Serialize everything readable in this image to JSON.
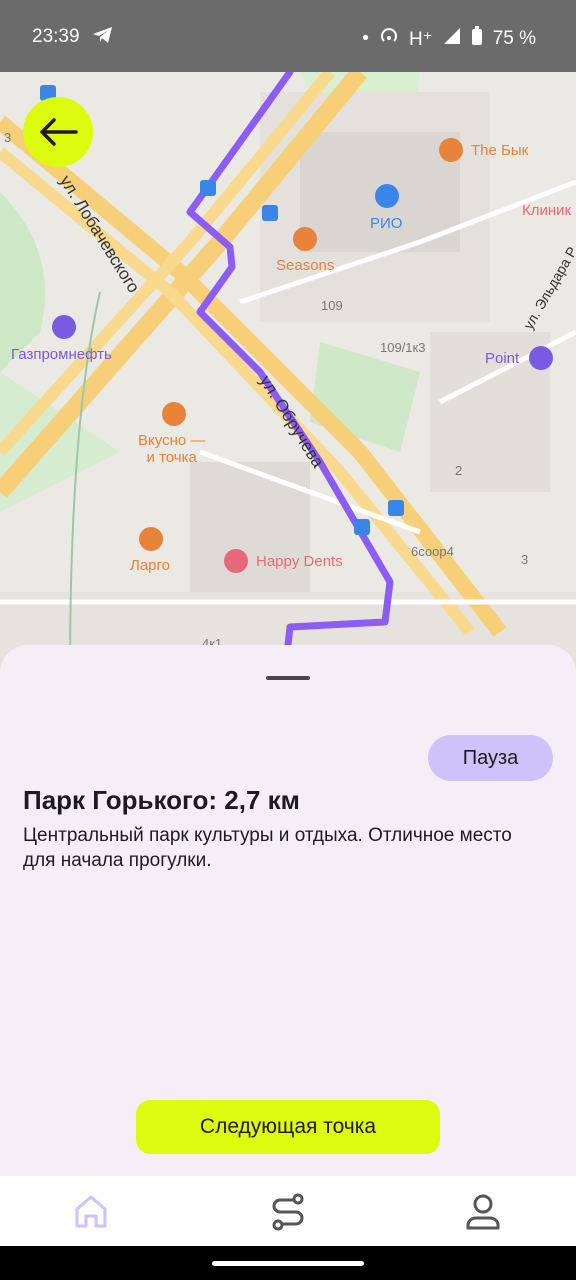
{
  "status_bar": {
    "time": "23:39",
    "network": "H⁺",
    "battery": "75 %"
  },
  "map": {
    "streets": [
      "ул. Лобачевского",
      "ул. Обручева",
      "ул. Эльдара Р"
    ],
    "pois": {
      "the_byk": "The Бык",
      "rio": "РИО",
      "seasons": "Seasons",
      "gazpromneft": "Газпромнефть",
      "vkusno": "Вкусно —\nи точка",
      "largo": "Ларго",
      "happy_dents": "Happy Dents",
      "point": "Point",
      "clinic": "Клиник"
    },
    "house_numbers": [
      "109",
      "109/1к3",
      "2",
      "6соор4",
      "3",
      "3",
      "4к1"
    ],
    "colors": {
      "route": "#8b5cf6",
      "road": "#f9d07a",
      "park": "#cde8c4",
      "poi_orange": "#e8833a",
      "poi_blue": "#3a86e8",
      "poi_purple": "#7a5ae0",
      "poi_pink": "#e86a7a"
    }
  },
  "sheet": {
    "pause_label": "Пауза",
    "title": "Парк Горького: 2,7 км",
    "description": "Центральный парк культуры и отдыха. Отличное место для начала прогулки.",
    "next_label": "Следующая точка"
  },
  "nav": {
    "items": [
      "home-icon",
      "route-icon",
      "profile-icon"
    ],
    "active": "home-icon"
  },
  "colors": {
    "accent": "#dcfc0f",
    "pause_bg": "#cdc2f9",
    "sheet_bg": "#f4eff7"
  }
}
